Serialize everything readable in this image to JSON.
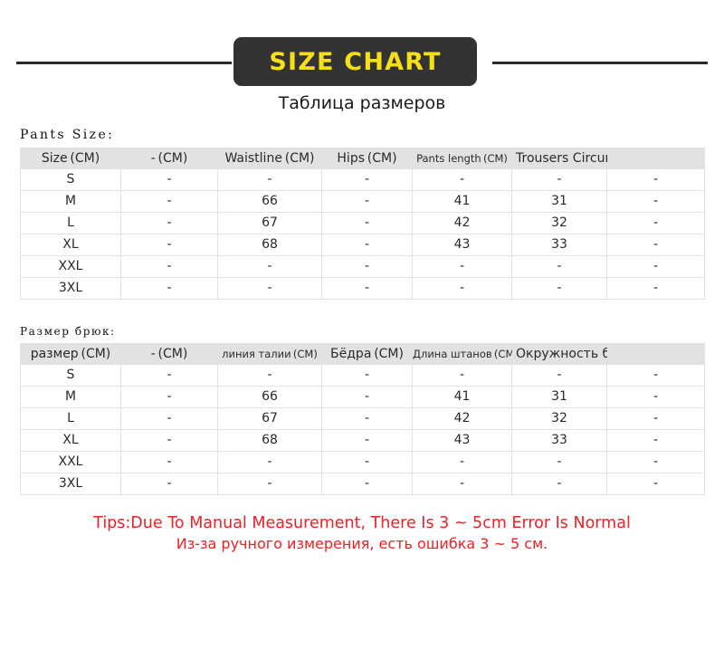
{
  "header": {
    "badge_label": "SIZE CHART",
    "subtitle": "Таблица размеров",
    "badge_bg": "#333333",
    "badge_text_color": "#F7DF18",
    "rule_color": "#2b2b2b"
  },
  "tables": [
    {
      "title": "Pants Size:",
      "columns": [
        "Size (CM)",
        "- (CM)",
        "Waistline (CM)",
        "Hips (CM)",
        "Pants length (CM)",
        "Trousers Circumference (CM)",
        ""
      ],
      "rows": [
        [
          "S",
          "-",
          "-",
          "-",
          "-",
          "-",
          "-"
        ],
        [
          "M",
          "-",
          "66",
          "-",
          "41",
          "31",
          "-"
        ],
        [
          "L",
          "-",
          "67",
          "-",
          "42",
          "32",
          "-"
        ],
        [
          "XL",
          "-",
          "68",
          "-",
          "43",
          "33",
          "-"
        ],
        [
          "XXL",
          "-",
          "-",
          "-",
          "-",
          "-",
          "-"
        ],
        [
          "3XL",
          "-",
          "-",
          "-",
          "-",
          "-",
          "-"
        ]
      ]
    },
    {
      "title": "Размер брюк:",
      "columns": [
        "размер (СМ)",
        "- (СМ)",
        "линия талии (СМ)",
        "Бёдра (СМ)",
        "Длина штанов (СМ)",
        "Окружность брюк (СМ)",
        ""
      ],
      "rows": [
        [
          "S",
          "-",
          "-",
          "-",
          "-",
          "-",
          "-"
        ],
        [
          "M",
          "-",
          "66",
          "-",
          "41",
          "31",
          "-"
        ],
        [
          "L",
          "-",
          "67",
          "-",
          "42",
          "32",
          "-"
        ],
        [
          "XL",
          "-",
          "68",
          "-",
          "43",
          "33",
          "-"
        ],
        [
          "XXL",
          "-",
          "-",
          "-",
          "-",
          "-",
          "-"
        ],
        [
          "3XL",
          "-",
          "-",
          "-",
          "-",
          "-",
          "-"
        ]
      ]
    }
  ],
  "tips": {
    "line_en": "Tips:Due To Manual Measurement, There Is 3 ~ 5cm Error Is Normal",
    "line_ru": "Из-за ручного измерения, есть ошибка 3 ~ 5 см.",
    "color": "#ED2024"
  }
}
